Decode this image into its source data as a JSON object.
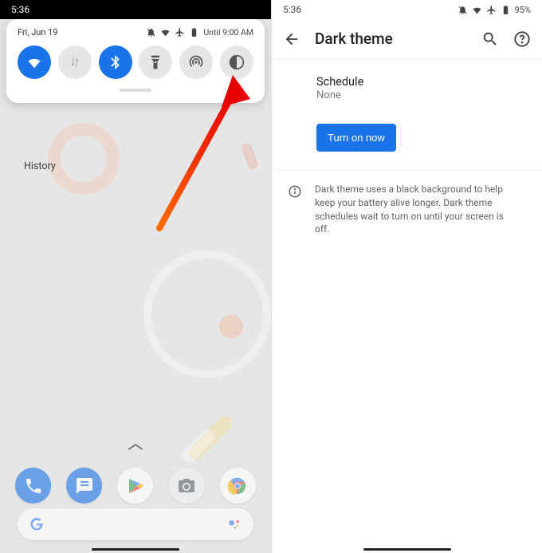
{
  "left": {
    "statusbar_time": "5:36",
    "qs_date": "Fri, Jun 19",
    "qs_until": "Until 9:00 AM",
    "history_label": "History",
    "tiles": {
      "wifi": "Wi-Fi",
      "data": "Mobile data",
      "bluetooth": "Bluetooth",
      "flashlight": "Flashlight",
      "hotspot": "Hotspot",
      "dark_theme": "Dark theme"
    }
  },
  "right": {
    "statusbar_time": "5:36",
    "battery_pct": "95%",
    "title": "Dark theme",
    "schedule_label": "Schedule",
    "schedule_value": "None",
    "turn_on_label": "Turn on now",
    "info_text": "Dark theme uses a black background to help keep your battery alive longer. Dark theme schedules wait to turn on until your screen is off."
  }
}
